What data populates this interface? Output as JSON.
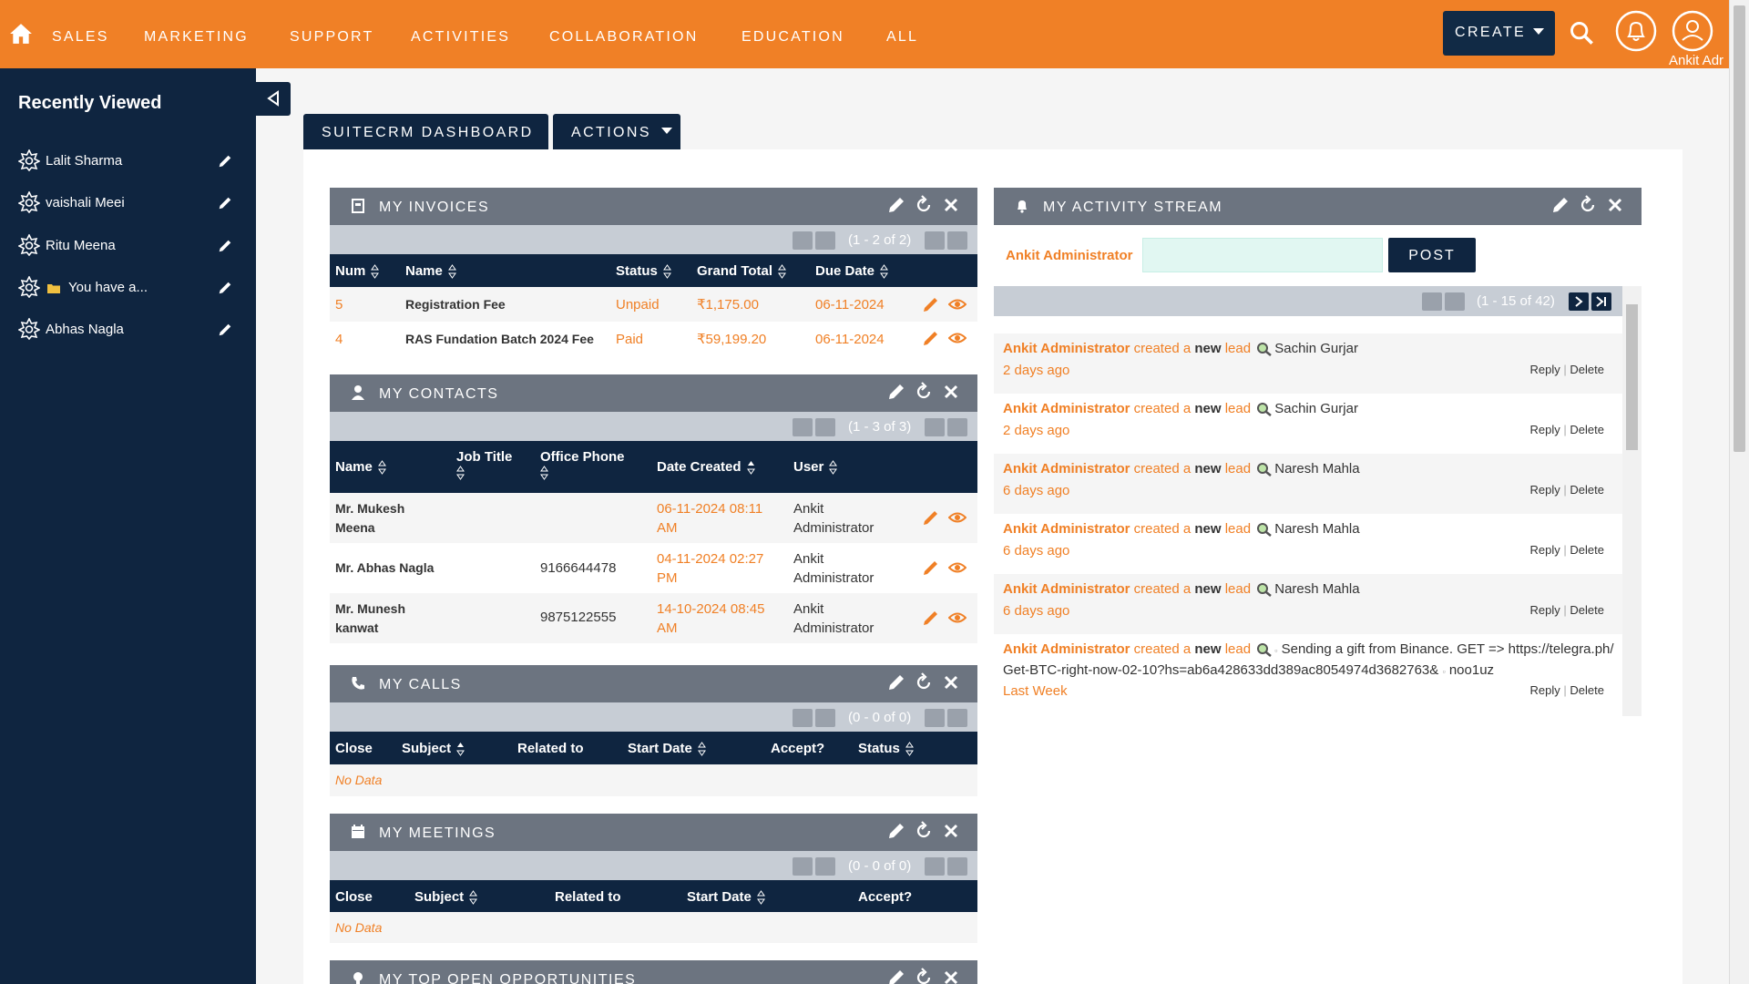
{
  "nav": {
    "items": [
      "Sales",
      "Marketing",
      "Support",
      "Activities",
      "Collaboration",
      "Education",
      "All"
    ],
    "create_label": "CREATE",
    "username": "Ankit Adr"
  },
  "sidebar": {
    "title": "Recently Viewed",
    "items": [
      {
        "label": "Lalit Sharma"
      },
      {
        "label": "vaishali Meei"
      },
      {
        "label": "Ritu Meena"
      },
      {
        "label": "You have a..."
      },
      {
        "label": "Abhas Nagla"
      }
    ]
  },
  "tabs": {
    "dashboard": "SUITECRM DASHBOARD",
    "actions": "ACTIONS"
  },
  "invoices": {
    "title": "MY INVOICES",
    "pager": "(1 - 2 of 2)",
    "columns": [
      "Num",
      "Name",
      "Status",
      "Grand Total",
      "Due Date"
    ],
    "rows": [
      {
        "num": "5",
        "name": "Registration Fee",
        "status": "Unpaid",
        "total": "₹1,175.00",
        "due": "06-11-2024"
      },
      {
        "num": "4",
        "name": "RAS Fundation Batch 2024 Fee",
        "status": "Paid",
        "total": "₹59,199.20",
        "due": "06-11-2024"
      }
    ]
  },
  "contacts": {
    "title": "MY CONTACTS",
    "pager": "(1 - 3 of 3)",
    "columns": [
      "Name",
      "Job Title",
      "Office Phone",
      "Date Created",
      "User"
    ],
    "rows": [
      {
        "name1": "Mr. Mukesh",
        "name2": "Meena",
        "phone": "",
        "date1": "06-11-2024 08:11",
        "date2": "AM",
        "user1": "Ankit",
        "user2": "Administrator"
      },
      {
        "name1": "Mr. Abhas Nagla",
        "name2": "",
        "phone": "9166644478",
        "date1": "04-11-2024 02:27",
        "date2": "PM",
        "user1": "Ankit",
        "user2": "Administrator"
      },
      {
        "name1": "Mr. Munesh",
        "name2": "kanwat",
        "phone": "9875122555",
        "date1": "14-10-2024 08:45",
        "date2": "AM",
        "user1": "Ankit",
        "user2": "Administrator"
      }
    ]
  },
  "calls": {
    "title": "MY CALLS",
    "pager": "(0 - 0 of 0)",
    "columns": [
      "Close",
      "Subject",
      "Related to",
      "Start Date",
      "Accept?",
      "Status"
    ],
    "empty": "No Data"
  },
  "meetings": {
    "title": "MY MEETINGS",
    "pager": "(0 - 0 of 0)",
    "columns": [
      "Close",
      "Subject",
      "Related to",
      "Start Date",
      "Accept?"
    ],
    "empty": "No Data"
  },
  "opportunities": {
    "title": "MY TOP OPEN OPPORTUNITIES"
  },
  "activity": {
    "title": "MY ACTIVITY STREAM",
    "user": "Ankit Administrator",
    "post_label": "POST",
    "pager": "(1 - 15 of 42)",
    "reply": "Reply",
    "delete": "Delete",
    "sep": "|",
    "items": [
      {
        "actor": "Ankit Administrator",
        "verb": "created a",
        "adj": "new",
        "type": "lead",
        "target": "Sachin Gurjar",
        "when": "2 days ago"
      },
      {
        "actor": "Ankit Administrator",
        "verb": "created a",
        "adj": "new",
        "type": "lead",
        "target": "Sachin Gurjar",
        "when": "2 days ago"
      },
      {
        "actor": "Ankit Administrator",
        "verb": "created a",
        "adj": "new",
        "type": "lead",
        "target": "Naresh Mahla",
        "when": "6 days ago"
      },
      {
        "actor": "Ankit Administrator",
        "verb": "created a",
        "adj": "new",
        "type": "lead",
        "target": "Naresh Mahla",
        "when": "6 days ago"
      },
      {
        "actor": "Ankit Administrator",
        "verb": "created a",
        "adj": "new",
        "type": "lead",
        "target": "Naresh Mahla",
        "when": "6 days ago"
      }
    ],
    "last": {
      "actor": "Ankit Administrator",
      "verb": "created a",
      "adj": "new",
      "type": "lead",
      "text1": "Sending a gift from Binance. GET => https://telegra.ph/",
      "text2": "Get-BTC-right-now-02-10?hs=ab6a428633dd389ac8054974d3682763&",
      "text3": "noo1uz",
      "when": "Last Week"
    }
  },
  "colors": {
    "orange": "#f08026",
    "navy": "#0f2540",
    "panel_header": "#6c7480"
  }
}
